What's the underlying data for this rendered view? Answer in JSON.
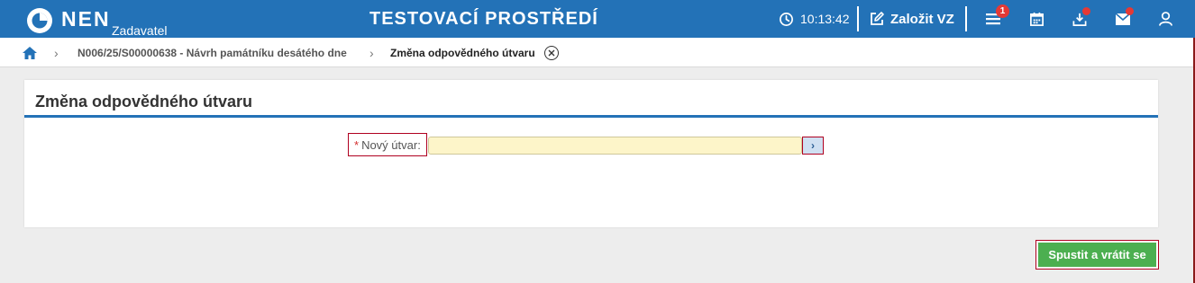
{
  "header": {
    "logo_text": "NEN",
    "logo_sub": "Zadavatel",
    "environment_title": "TESTOVACÍ PROSTŘEDÍ",
    "clock": "10:13:42",
    "create_label": "Založit VZ",
    "menu_badge": "1",
    "colors": {
      "bar": "#2372b7",
      "badge": "#e53935"
    }
  },
  "breadcrumb": {
    "items": [
      {
        "label": "N006/25/S00000638 - Návrh památníku desátého dne"
      },
      {
        "label": "Změna odpovědného útvaru"
      }
    ]
  },
  "panel": {
    "title": "Změna odpovědného útvaru",
    "field": {
      "required_mark": "*",
      "label": "Nový útvar:",
      "value": "",
      "button_icon": "chevron-right-icon"
    }
  },
  "actions": {
    "submit_label": "Spustit a vrátit se",
    "submit_color": "#4caf50"
  }
}
